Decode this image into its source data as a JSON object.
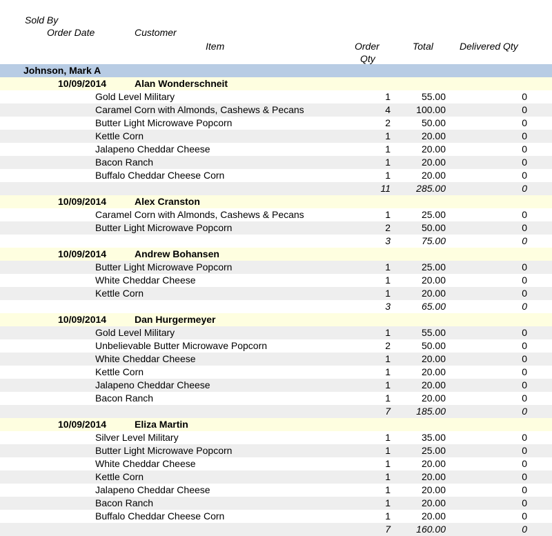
{
  "headers": {
    "sold_by": "Sold By",
    "order_date": "Order Date",
    "customer": "Customer",
    "item": "Item",
    "order_qty_1": "Order",
    "order_qty_2": "Qty",
    "total": "Total",
    "delivered_qty": "Delivered Qty"
  },
  "seller": "Johnson, Mark A",
  "orders": [
    {
      "date": "10/09/2014",
      "customer": "Alan Wonderschneit",
      "items": [
        {
          "name": "Gold Level Military",
          "qty": "1",
          "total": "55.00",
          "delivered": "0"
        },
        {
          "name": "Caramel Corn with Almonds, Cashews & Pecans",
          "qty": "4",
          "total": "100.00",
          "delivered": "0"
        },
        {
          "name": "Butter Light Microwave Popcorn",
          "qty": "2",
          "total": "50.00",
          "delivered": "0"
        },
        {
          "name": "Kettle Corn",
          "qty": "1",
          "total": "20.00",
          "delivered": "0"
        },
        {
          "name": "Jalapeno Cheddar Cheese",
          "qty": "1",
          "total": "20.00",
          "delivered": "0"
        },
        {
          "name": "Bacon Ranch",
          "qty": "1",
          "total": "20.00",
          "delivered": "0"
        },
        {
          "name": "Buffalo Cheddar Cheese Corn",
          "qty": "1",
          "total": "20.00",
          "delivered": "0"
        }
      ],
      "subtotal": {
        "qty": "11",
        "total": "285.00",
        "delivered": "0"
      }
    },
    {
      "date": "10/09/2014",
      "customer": "Alex Cranston",
      "items": [
        {
          "name": "Caramel Corn with Almonds, Cashews & Pecans",
          "qty": "1",
          "total": "25.00",
          "delivered": "0"
        },
        {
          "name": "Butter Light Microwave Popcorn",
          "qty": "2",
          "total": "50.00",
          "delivered": "0"
        }
      ],
      "subtotal": {
        "qty": "3",
        "total": "75.00",
        "delivered": "0"
      }
    },
    {
      "date": "10/09/2014",
      "customer": "Andrew Bohansen",
      "items": [
        {
          "name": "Butter Light Microwave Popcorn",
          "qty": "1",
          "total": "25.00",
          "delivered": "0"
        },
        {
          "name": "White Cheddar Cheese",
          "qty": "1",
          "total": "20.00",
          "delivered": "0"
        },
        {
          "name": "Kettle Corn",
          "qty": "1",
          "total": "20.00",
          "delivered": "0"
        }
      ],
      "subtotal": {
        "qty": "3",
        "total": "65.00",
        "delivered": "0"
      }
    },
    {
      "date": "10/09/2014",
      "customer": "Dan Hurgermeyer",
      "items": [
        {
          "name": "Gold Level Military",
          "qty": "1",
          "total": "55.00",
          "delivered": "0"
        },
        {
          "name": "Unbelievable Butter Microwave Popcorn",
          "qty": "2",
          "total": "50.00",
          "delivered": "0"
        },
        {
          "name": "White Cheddar Cheese",
          "qty": "1",
          "total": "20.00",
          "delivered": "0"
        },
        {
          "name": "Kettle Corn",
          "qty": "1",
          "total": "20.00",
          "delivered": "0"
        },
        {
          "name": "Jalapeno Cheddar Cheese",
          "qty": "1",
          "total": "20.00",
          "delivered": "0"
        },
        {
          "name": "Bacon Ranch",
          "qty": "1",
          "total": "20.00",
          "delivered": "0"
        }
      ],
      "subtotal": {
        "qty": "7",
        "total": "185.00",
        "delivered": "0"
      }
    },
    {
      "date": "10/09/2014",
      "customer": "Eliza Martin",
      "items": [
        {
          "name": "Silver Level Military",
          "qty": "1",
          "total": "35.00",
          "delivered": "0"
        },
        {
          "name": "Butter Light Microwave Popcorn",
          "qty": "1",
          "total": "25.00",
          "delivered": "0"
        },
        {
          "name": "White Cheddar Cheese",
          "qty": "1",
          "total": "20.00",
          "delivered": "0"
        },
        {
          "name": "Kettle Corn",
          "qty": "1",
          "total": "20.00",
          "delivered": "0"
        },
        {
          "name": "Jalapeno Cheddar Cheese",
          "qty": "1",
          "total": "20.00",
          "delivered": "0"
        },
        {
          "name": "Bacon Ranch",
          "qty": "1",
          "total": "20.00",
          "delivered": "0"
        },
        {
          "name": "Buffalo Cheddar Cheese Corn",
          "qty": "1",
          "total": "20.00",
          "delivered": "0"
        }
      ],
      "subtotal": {
        "qty": "7",
        "total": "160.00",
        "delivered": "0"
      }
    }
  ]
}
